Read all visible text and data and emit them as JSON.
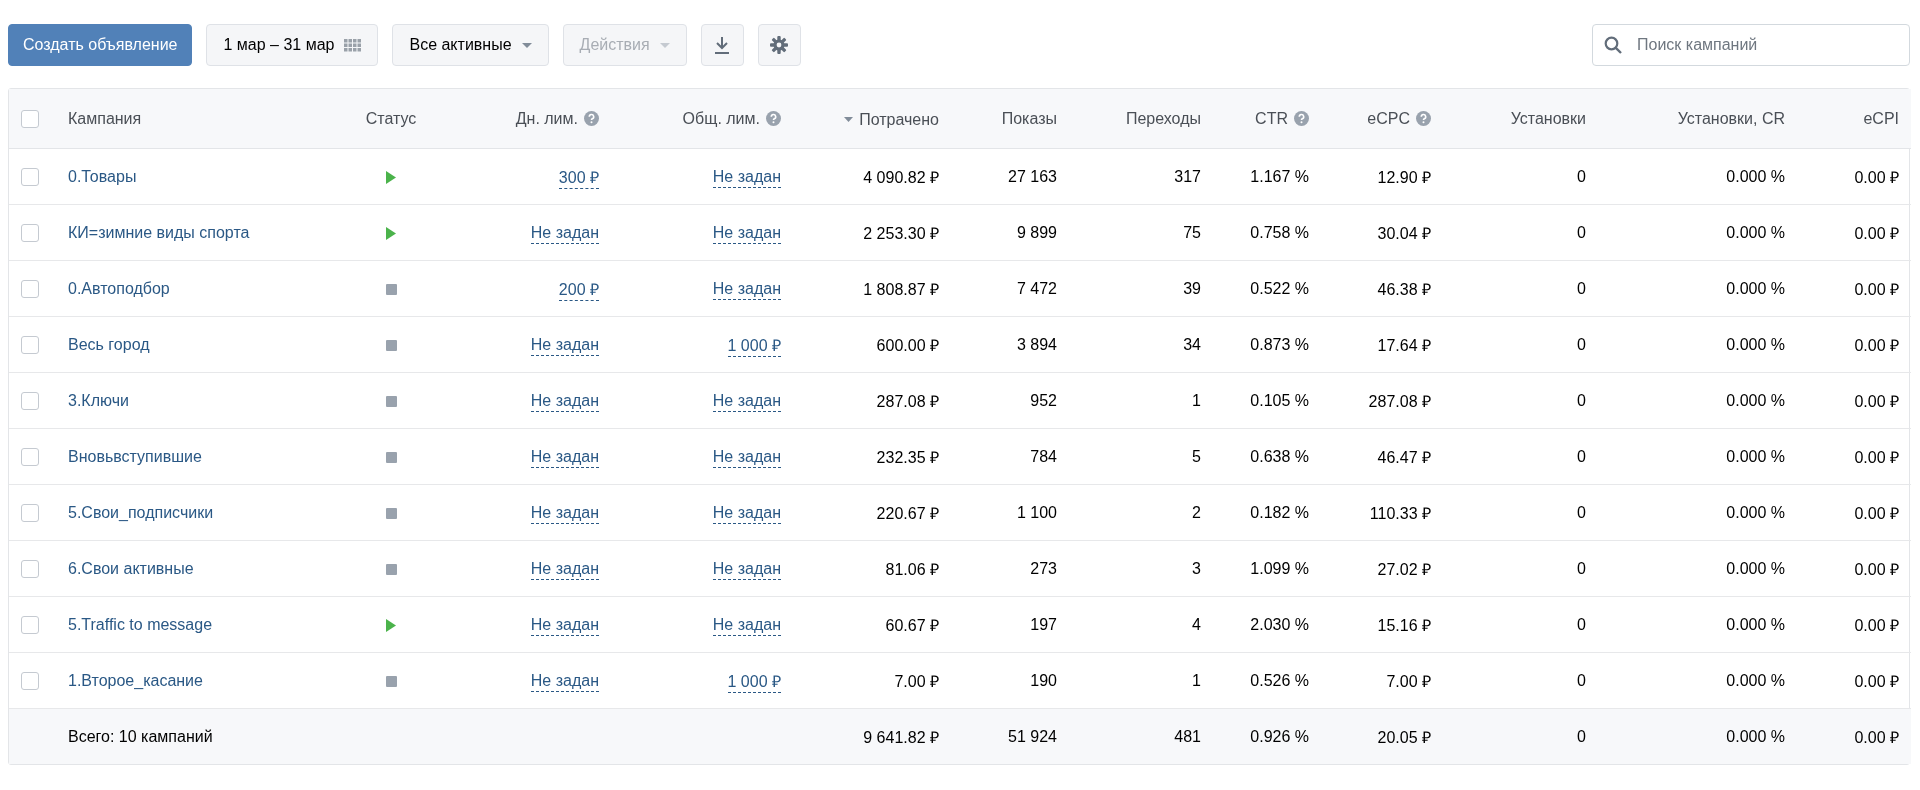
{
  "toolbar": {
    "create_button": "Создать объявление",
    "date_range": "1 мар – 31 мар",
    "filter": "Все активные",
    "actions": {
      "label": "Действия",
      "disabled": true
    },
    "search": {
      "placeholder": "Поиск кампаний"
    }
  },
  "table": {
    "select_all_checked": false,
    "columns": [
      {
        "label": "Кампания"
      },
      {
        "label": "Статус"
      },
      {
        "label": "Дн. лим.",
        "help": true
      },
      {
        "label": "Общ. лим.",
        "help": true
      },
      {
        "label": "Потрачено",
        "sorted": true
      },
      {
        "label": "Показы"
      },
      {
        "label": "Переходы"
      },
      {
        "label": "CTR",
        "help": true
      },
      {
        "label": "eCPC",
        "help": true
      },
      {
        "label": "Установки"
      },
      {
        "label": "Установки, CR"
      },
      {
        "label": "eCPI"
      }
    ],
    "rows": [
      {
        "checked": false,
        "running": true,
        "cells": [
          "0.Товары",
          "",
          "300 ₽",
          "Не задан",
          "4 090.82 ₽",
          "27 163",
          "317",
          "1.167 %",
          "12.90 ₽",
          "0",
          "0.000 %",
          "0.00 ₽"
        ]
      },
      {
        "checked": false,
        "running": true,
        "cells": [
          "КИ=зимние виды спорта",
          "",
          "Не задан",
          "Не задан",
          "2 253.30 ₽",
          "9 899",
          "75",
          "0.758 %",
          "30.04 ₽",
          "0",
          "0.000 %",
          "0.00 ₽"
        ]
      },
      {
        "checked": false,
        "running": false,
        "cells": [
          "0.Автоподбор",
          "",
          "200 ₽",
          "Не задан",
          "1 808.87 ₽",
          "7 472",
          "39",
          "0.522 %",
          "46.38 ₽",
          "0",
          "0.000 %",
          "0.00 ₽"
        ]
      },
      {
        "checked": false,
        "running": false,
        "cells": [
          "Весь город",
          "",
          "Не задан",
          "1 000 ₽",
          "600.00 ₽",
          "3 894",
          "34",
          "0.873 %",
          "17.64 ₽",
          "0",
          "0.000 %",
          "0.00 ₽"
        ]
      },
      {
        "checked": false,
        "running": false,
        "cells": [
          "3.Ключи",
          "",
          "Не задан",
          "Не задан",
          "287.08 ₽",
          "952",
          "1",
          "0.105 %",
          "287.08 ₽",
          "0",
          "0.000 %",
          "0.00 ₽"
        ]
      },
      {
        "checked": false,
        "running": false,
        "cells": [
          "Вновьвступившие",
          "",
          "Не задан",
          "Не задан",
          "232.35 ₽",
          "784",
          "5",
          "0.638 %",
          "46.47 ₽",
          "0",
          "0.000 %",
          "0.00 ₽"
        ]
      },
      {
        "checked": false,
        "running": false,
        "cells": [
          "5.Свои_подписчики",
          "",
          "Не задан",
          "Не задан",
          "220.67 ₽",
          "1 100",
          "2",
          "0.182 %",
          "110.33 ₽",
          "0",
          "0.000 %",
          "0.00 ₽"
        ]
      },
      {
        "checked": false,
        "running": false,
        "cells": [
          "6.Свои активные",
          "",
          "Не задан",
          "Не задан",
          "81.06 ₽",
          "273",
          "3",
          "1.099 %",
          "27.02 ₽",
          "0",
          "0.000 %",
          "0.00 ₽"
        ]
      },
      {
        "checked": false,
        "running": true,
        "cells": [
          "5.Traffic to message",
          "",
          "Не задан",
          "Не задан",
          "60.67 ₽",
          "197",
          "4",
          "2.030 %",
          "15.16 ₽",
          "0",
          "0.000 %",
          "0.00 ₽"
        ]
      },
      {
        "checked": false,
        "running": false,
        "cells": [
          "1.Второе_касание",
          "",
          "Не задан",
          "1 000 ₽",
          "7.00 ₽",
          "190",
          "1",
          "0.526 %",
          "7.00 ₽",
          "0",
          "0.000 %",
          "0.00 ₽"
        ]
      }
    ],
    "total": {
      "cells": [
        "Всего: 10 кампаний",
        "",
        "",
        "",
        "9 641.82 ₽",
        "51 924",
        "481",
        "0.926 %",
        "20.05 ₽",
        "0",
        "0.000 %",
        "0.00 ₽"
      ]
    }
  }
}
